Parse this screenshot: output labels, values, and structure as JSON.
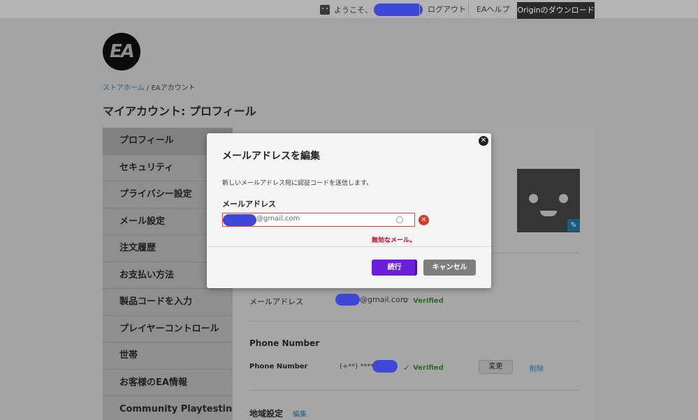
{
  "topbar": {
    "welcome": "ようこそ、",
    "logout": "ログアウト",
    "help": "EAヘルプ",
    "download": "Originのダウンロード"
  },
  "logo": {
    "text": "EA"
  },
  "breadcrumb": {
    "home": "ストアホーム",
    "separator": " / ",
    "current": "EAアカウント"
  },
  "page": {
    "title": "マイアカウント: プロフィール"
  },
  "sidebar": {
    "items": [
      {
        "label": "プロフィール"
      },
      {
        "label": "セキュリティ"
      },
      {
        "label": "プライバシー設定"
      },
      {
        "label": "メール設定"
      },
      {
        "label": "注文履歴"
      },
      {
        "label": "お支払い方法"
      },
      {
        "label": "製品コードを入力"
      },
      {
        "label": "プレイヤーコントロール"
      },
      {
        "label": "世帯"
      },
      {
        "label": "お客様のEA情報"
      },
      {
        "label": "Community Playtesting"
      }
    ]
  },
  "main": {
    "email_row": {
      "label": "メールアドレス",
      "value_suffix": "@gmail.com",
      "status": "Verified"
    },
    "phone_section": {
      "title": "Phone Number"
    },
    "phone_row": {
      "label": "Phone Number",
      "value_prefix": "(+**) ****",
      "status": "Verified",
      "change_label": "変更",
      "delete_label": "削除"
    },
    "region_section": {
      "title": "地域設定",
      "edit_label": "編集"
    }
  },
  "modal": {
    "title": "メールアドレスを編集",
    "description": "新しいメールアドレス宛に認証コードを送信します。",
    "field_label": "メールアドレス",
    "email_suffix": "@gmail.com",
    "error": "無効なメール。",
    "continue_label": "続行",
    "cancel_label": "キャンセル",
    "close_symbol": "✕"
  },
  "icons": {
    "close": "close-icon",
    "error": "error-icon",
    "check": "check-icon",
    "edit": "pencil-icon",
    "avatar": "avatar-icon"
  },
  "colors": {
    "accent_purple": "#6c1fd8",
    "error_red": "#d0021b",
    "verified_green": "#2c6a24",
    "link_blue": "#1d5f86",
    "redaction_blue": "#3f48d6"
  }
}
